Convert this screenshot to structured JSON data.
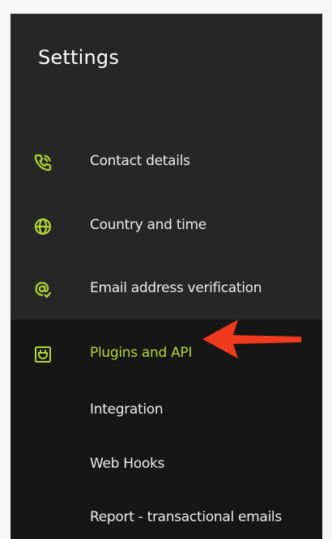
{
  "sidebar": {
    "title": "Settings",
    "items": [
      {
        "label": "Contact details",
        "icon": "phone-icon"
      },
      {
        "label": "Country and time",
        "icon": "globe-icon"
      },
      {
        "label": "Email address verification",
        "icon": "at-check-icon"
      },
      {
        "label": "Plugins and API",
        "icon": "plugin-icon",
        "active": true
      }
    ],
    "subitems": [
      {
        "label": "Integration"
      },
      {
        "label": "Web Hooks"
      },
      {
        "label": "Report - transactional emails"
      }
    ]
  },
  "colors": {
    "accent": "#b5d334",
    "panel": "#262626",
    "active_bg": "#161616",
    "text": "#ececec",
    "annotation_arrow": "#f03a1e"
  }
}
